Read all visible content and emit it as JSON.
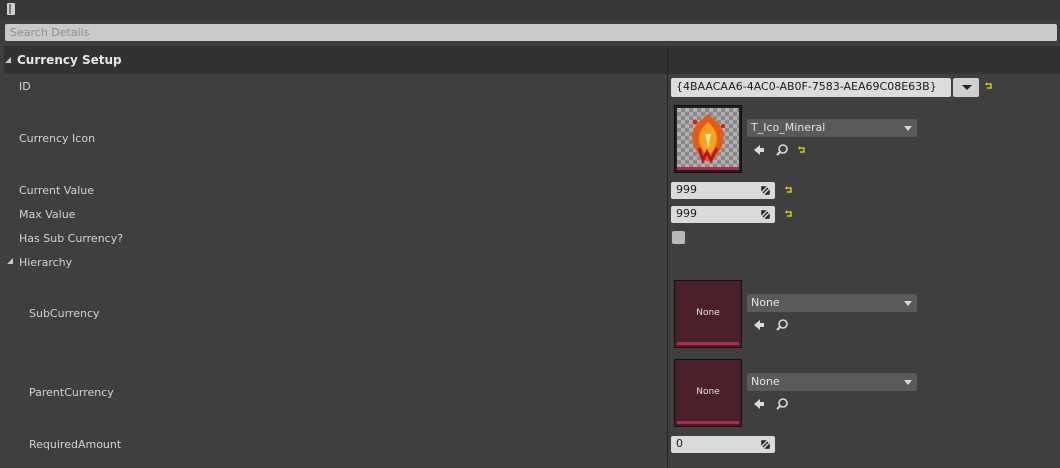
{
  "toolbar": {
    "lock_icon": "lock-icon"
  },
  "search": {
    "placeholder": "Search Details"
  },
  "category": {
    "title": "Currency Setup"
  },
  "properties": {
    "id": {
      "label": "ID",
      "value": "{4BAACAA6-4AC0-AB0F-7583-AEA69C08E63B}"
    },
    "currency_icon": {
      "label": "Currency Icon",
      "asset": "T_Ico_Mineral"
    },
    "current_value": {
      "label": "Current Value",
      "value": "999"
    },
    "max_value": {
      "label": "Max Value",
      "value": "999"
    },
    "has_sub_currency": {
      "label": "Has Sub Currency?",
      "checked": false
    },
    "hierarchy": {
      "label": "Hierarchy",
      "sub_currency": {
        "label": "SubCurrency",
        "thumb_text": "None",
        "value": "None"
      },
      "parent_currency": {
        "label": "ParentCurrency",
        "thumb_text": "None",
        "value": "None"
      },
      "required_amount": {
        "label": "RequiredAmount",
        "value": "0"
      }
    }
  },
  "colors": {
    "reset_arrow": "#d8c51a",
    "asset_bar": "#b3284f",
    "none_thumb_bg": "#4a1f2c"
  }
}
